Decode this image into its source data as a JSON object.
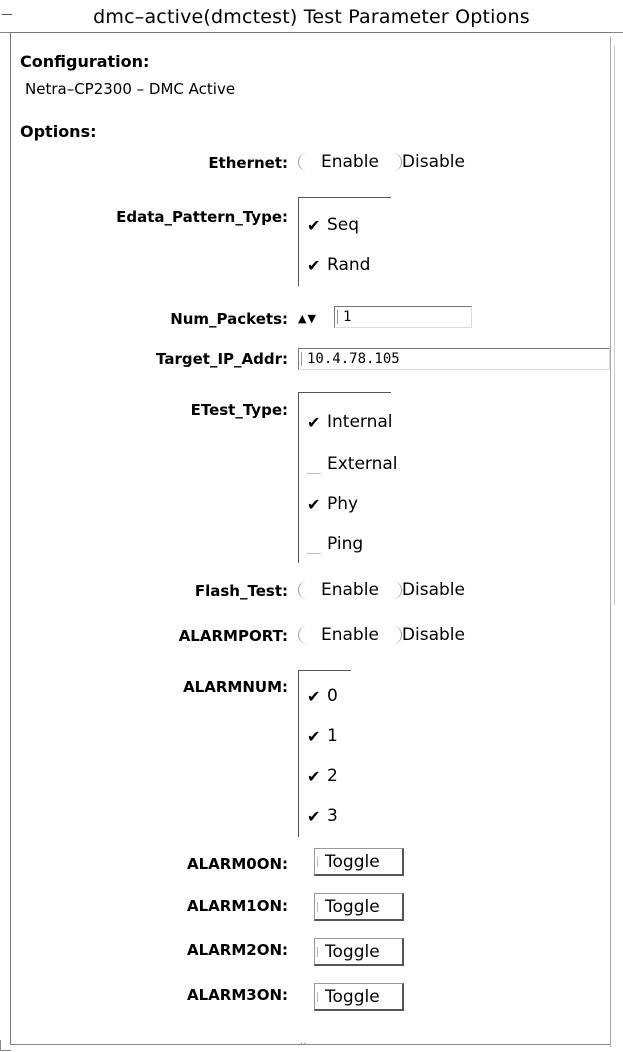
{
  "window": {
    "title": "dmc–active(dmctest) Test Parameter Options"
  },
  "configuration": {
    "label": "Configuration:",
    "value": "Netra–CP2300 – DMC Active"
  },
  "options": {
    "label": "Options:",
    "ethernet": {
      "label": "Ethernet:",
      "enable": "Enable",
      "disable": "Disable"
    },
    "edata_pattern_type": {
      "label": "Edata_Pattern_Type:",
      "items": [
        {
          "label": "Seq",
          "checked": true
        },
        {
          "label": "Rand",
          "checked": true
        }
      ]
    },
    "num_packets": {
      "label": "Num_Packets:",
      "arrows": "▲▼",
      "value": "1"
    },
    "target_ip_addr": {
      "label": "Target_IP_Addr:",
      "value": "10.4.78.105"
    },
    "etest_type": {
      "label": "ETest_Type:",
      "items": [
        {
          "label": "Internal",
          "checked": true
        },
        {
          "label": "External",
          "checked": false
        },
        {
          "label": "Phy",
          "checked": true
        },
        {
          "label": "Ping",
          "checked": false
        }
      ]
    },
    "flash_test": {
      "label": "Flash_Test:",
      "enable": "Enable",
      "disable": "Disable"
    },
    "alarmport": {
      "label": "ALARMPORT:",
      "enable": "Enable",
      "disable": "Disable"
    },
    "alarmnum": {
      "label": "ALARMNUM:",
      "items": [
        {
          "label": "0",
          "checked": true
        },
        {
          "label": "1",
          "checked": true
        },
        {
          "label": "2",
          "checked": true
        },
        {
          "label": "3",
          "checked": true
        }
      ]
    },
    "alarm_toggles": [
      {
        "label": "ALARM0ON:",
        "button": "Toggle"
      },
      {
        "label": "ALARM1ON:",
        "button": "Toggle"
      },
      {
        "label": "ALARM2ON:",
        "button": "Toggle"
      },
      {
        "label": "ALARM3ON:",
        "button": "Toggle"
      }
    ]
  },
  "icons": {
    "check": "check-mark-icon",
    "spinner": "spinner-arrows-icon"
  }
}
